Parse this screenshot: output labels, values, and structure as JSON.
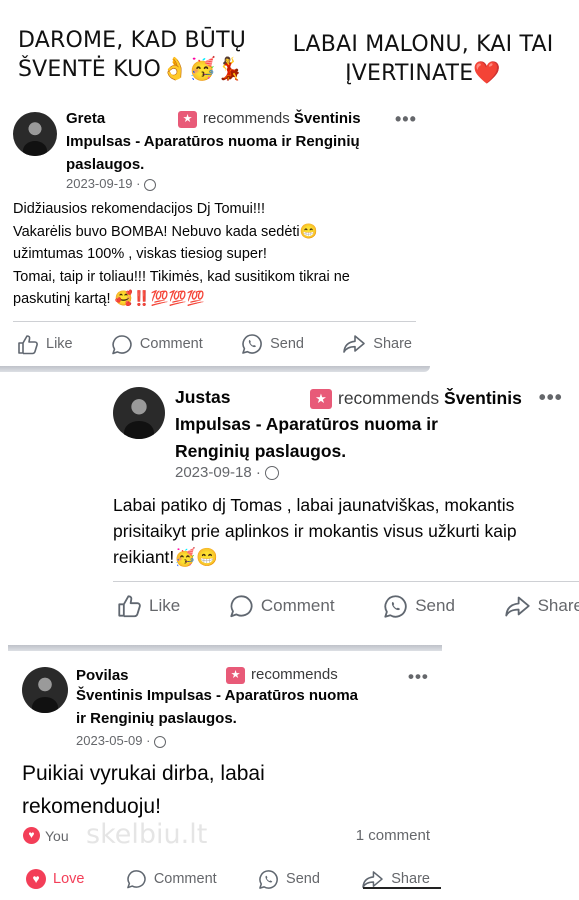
{
  "headlines": {
    "left": [
      "DAROME, KAD BŪTŲ",
      "ŠVENTĖ KUO👌🥳💃"
    ],
    "right": [
      "LABAI MALONU, KAI TAI",
      "ĮVERTINATE❤️"
    ]
  },
  "actions": {
    "like": "Like",
    "love": "Love",
    "comment": "Comment",
    "send": "Send",
    "share": "Share"
  },
  "reviews": [
    {
      "name": "Greta",
      "recommends": "recommends",
      "page_start": "Šventinis",
      "page_rest": "Impulsas - Aparatūros nuoma ir Renginių paslaugos.",
      "date": "2023-09-19 ·",
      "text": [
        "Didžiausios rekomendacijos Dj Tomui!!!",
        "Vakarėlis buvo BOMBA! Nebuvo kada sedėti😁",
        "užimtumas 100% , viskas tiesiog super!",
        "Tomai, taip ir toliau!!! Tikimės, kad susitikom tikrai ne",
        "paskutinį kartą! 🥰‼️💯💯💯"
      ]
    },
    {
      "name": "Justas",
      "recommends": "recommends",
      "page_start": "Šventinis",
      "page_rest": "Impulsas - Aparatūros nuoma ir Renginių paslaugos.",
      "date": "2023-09-18 ·",
      "text": [
        "Labai patiko dj Tomas , labai jaunatviškas, mokantis",
        "prisitaikyt prie aplinkos ir mokantis visus užkurti kaip",
        "reikiant!🥳😁"
      ]
    },
    {
      "name": "Povilas",
      "recommends": "recommends",
      "page_start": "Šventinis Impulsas - Aparatūros nuoma",
      "page_rest": "ir Renginių paslaugos.",
      "date": "2023-05-09 ·",
      "text": [
        "Puikiai vyrukai dirba, labai",
        "rekomenduoju!"
      ],
      "reaction_name": "You",
      "comments": "1 comment",
      "watermark": "skelbiu.lt"
    }
  ]
}
